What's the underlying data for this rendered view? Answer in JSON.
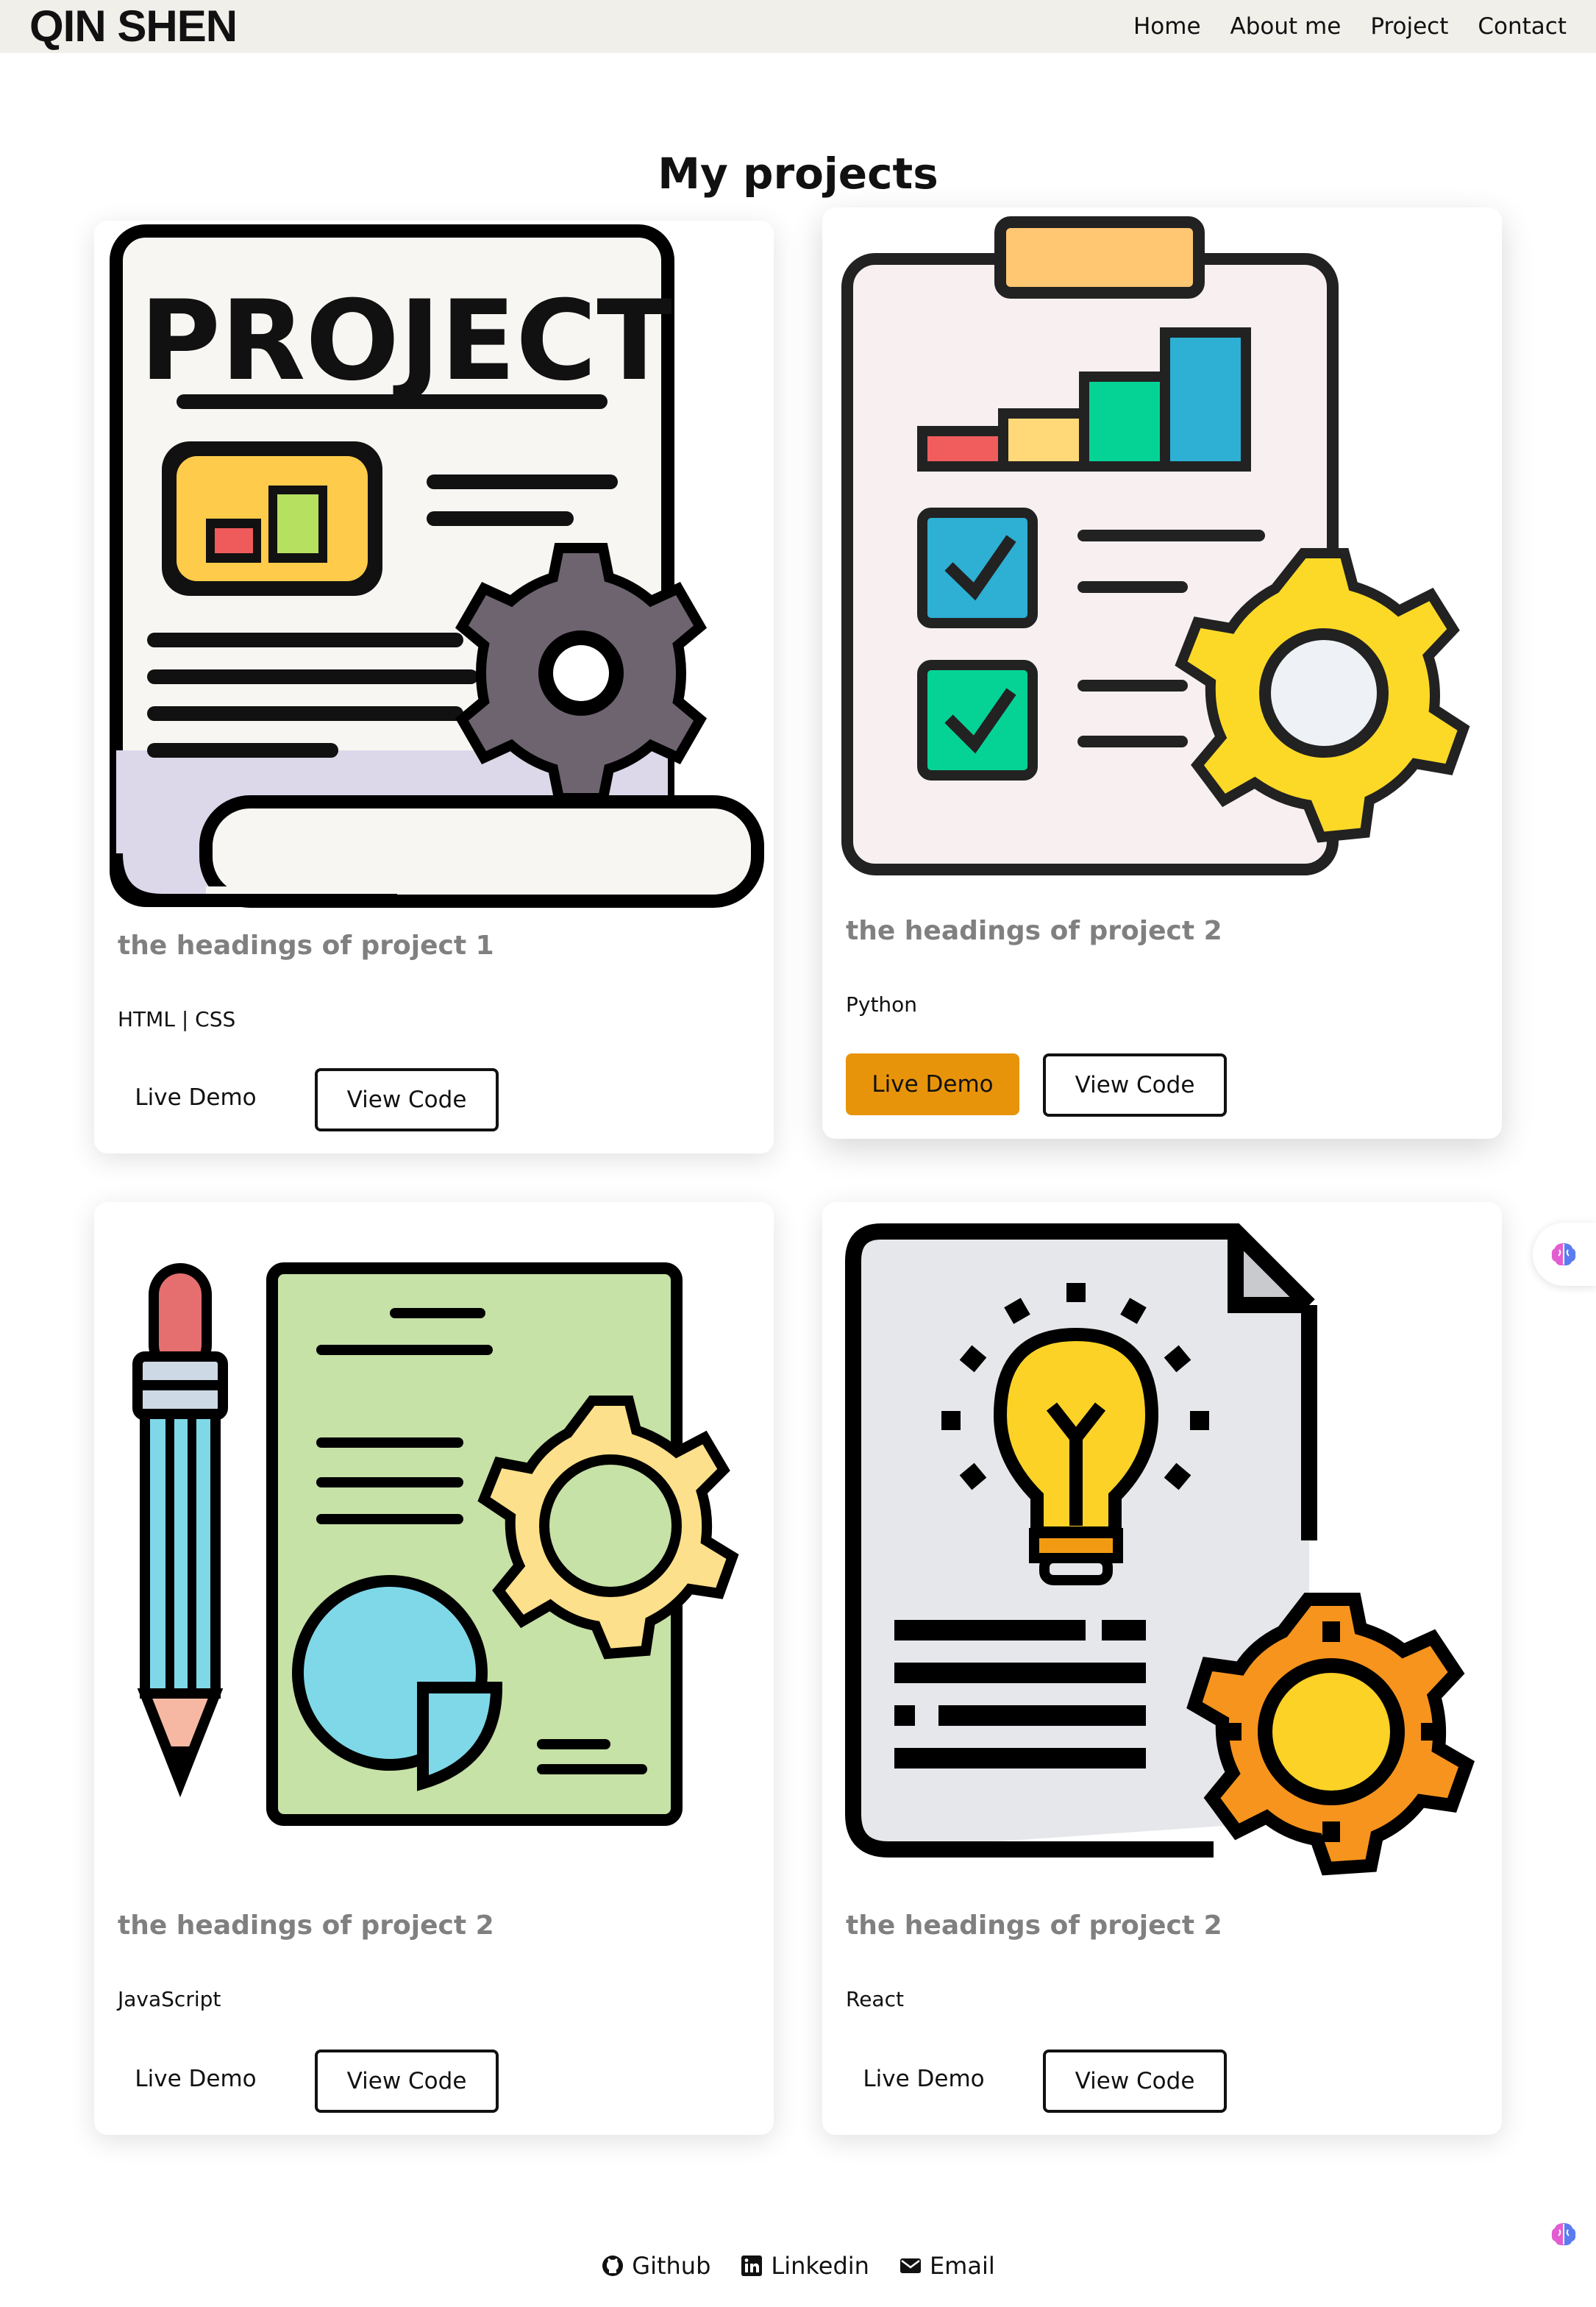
{
  "header": {
    "brand": "QIN SHEN",
    "nav": [
      "Home",
      "About me",
      "Project",
      "Contact"
    ]
  },
  "page_title": "My projects",
  "projects": [
    {
      "title": "the headings of project 1",
      "tech": "HTML | CSS",
      "demo_label": "Live Demo",
      "code_label": "View Code",
      "image_icon": "project-document-gear-icon",
      "demo_active": false
    },
    {
      "title": "the headings of project 2",
      "tech": "Python",
      "demo_label": "Live Demo",
      "code_label": "View Code",
      "image_icon": "clipboard-chart-gear-icon",
      "demo_active": true
    },
    {
      "title": "the headings of project 2",
      "tech": "JavaScript",
      "demo_label": "Live Demo",
      "code_label": "View Code",
      "image_icon": "pencil-document-gear-icon",
      "demo_active": false
    },
    {
      "title": "the headings of project 2",
      "tech": "React",
      "demo_label": "Live Demo",
      "code_label": "View Code",
      "image_icon": "lightbulb-document-gear-icon",
      "demo_active": false
    }
  ],
  "footer": {
    "links": [
      {
        "label": "Github",
        "icon": "github-icon"
      },
      {
        "label": "Linkedin",
        "icon": "linkedin-icon"
      },
      {
        "label": "Email",
        "icon": "envelope-icon"
      }
    ]
  },
  "colors": {
    "topbar": "#f1efea",
    "accent": "#e8940a",
    "heading_gray": "#808080"
  }
}
